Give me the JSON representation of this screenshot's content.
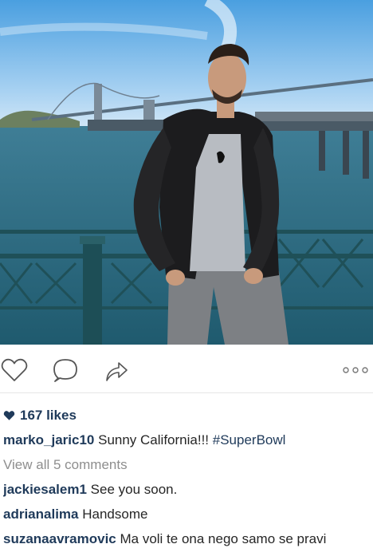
{
  "post": {
    "photo_alt": "",
    "actions": {
      "like_icon": "heart-outline-icon",
      "comment_icon": "speech-bubble-icon",
      "share_icon": "share-arrow-icon",
      "more_icon": "more-dots-icon"
    },
    "likes_text": "167 likes",
    "caption": {
      "username": "marko_jaric10",
      "text": "Sunny California!!!",
      "hashtag": "#SuperBowl"
    },
    "view_all_comments": "View all 5 comments",
    "comments": [
      {
        "username": "jackiesalem1",
        "text": "See you soon."
      },
      {
        "username": "adrianalima",
        "text": "Handsome"
      },
      {
        "username": "suzanaavramovic",
        "text": "Ma voli te ona nego samo se pravi"
      }
    ]
  },
  "colors": {
    "username": "#1f3a5a",
    "muted": "#8e8e8e",
    "sky": "#7fb8e8",
    "water": "#2f6f88"
  }
}
